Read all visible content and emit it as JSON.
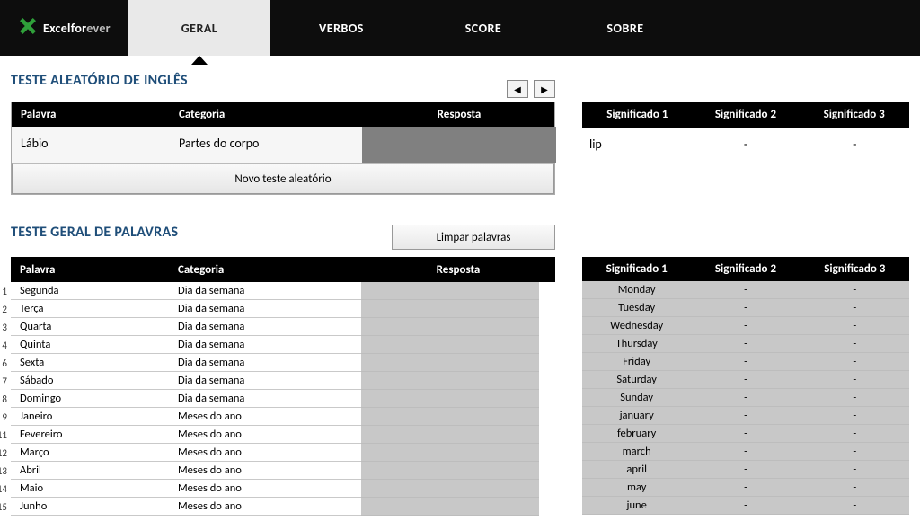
{
  "brand": {
    "name1": "Excel",
    "name2": "for",
    "name3": "ever"
  },
  "tabs": [
    {
      "label": "GERAL",
      "active": true
    },
    {
      "label": "VERBOS",
      "active": false
    },
    {
      "label": "SCORE",
      "active": false
    },
    {
      "label": "SOBRE",
      "active": false
    }
  ],
  "random_test": {
    "title": "TESTE ALEATÓRIO DE INGLÊS",
    "headers": {
      "word": "Palavra",
      "category": "Categoria",
      "answer": "Resposta"
    },
    "row": {
      "word": "Lábio",
      "category": "Partes do corpo",
      "answer": ""
    },
    "button": "Novo teste aleatório",
    "meaning_headers": {
      "m1": "Significado 1",
      "m2": "Significado 2",
      "m3": "Significado 3"
    },
    "meanings": {
      "m1": "lip",
      "m2": "-",
      "m3": "-"
    }
  },
  "word_test": {
    "title": "TESTE GERAL DE PALAVRAS",
    "clear_button": "Limpar palavras",
    "headers": {
      "word": "Palavra",
      "category": "Categoria",
      "answer": "Resposta"
    },
    "meaning_headers": {
      "m1": "Significado 1",
      "m2": "Significado 2",
      "m3": "Significado 3"
    },
    "rows": [
      {
        "n": "1",
        "word": "Segunda",
        "category": "Dia da semana",
        "m1": "Monday",
        "m2": "-",
        "m3": "-"
      },
      {
        "n": "2",
        "word": "Terça",
        "category": "Dia da semana",
        "m1": "Tuesday",
        "m2": "-",
        "m3": "-"
      },
      {
        "n": "3",
        "word": "Quarta",
        "category": "Dia da semana",
        "m1": "Wednesday",
        "m2": "-",
        "m3": "-"
      },
      {
        "n": "4",
        "word": "Quinta",
        "category": "Dia da semana",
        "m1": "Thursday",
        "m2": "-",
        "m3": "-"
      },
      {
        "n": "6",
        "word": "Sexta",
        "category": "Dia da semana",
        "m1": "Friday",
        "m2": "-",
        "m3": "-"
      },
      {
        "n": "7",
        "word": "Sábado",
        "category": "Dia da semana",
        "m1": "Saturday",
        "m2": "-",
        "m3": "-"
      },
      {
        "n": "8",
        "word": "Domingo",
        "category": "Dia da semana",
        "m1": "Sunday",
        "m2": "-",
        "m3": "-"
      },
      {
        "n": "9",
        "word": "Janeiro",
        "category": "Meses do ano",
        "m1": "january",
        "m2": "-",
        "m3": "-"
      },
      {
        "n": "11",
        "word": "Fevereiro",
        "category": "Meses do ano",
        "m1": "february",
        "m2": "-",
        "m3": "-"
      },
      {
        "n": "12",
        "word": "Março",
        "category": "Meses do ano",
        "m1": "march",
        "m2": "-",
        "m3": "-"
      },
      {
        "n": "13",
        "word": "Abril",
        "category": "Meses do ano",
        "m1": "april",
        "m2": "-",
        "m3": "-"
      },
      {
        "n": "14",
        "word": "Maio",
        "category": "Meses do ano",
        "m1": "may",
        "m2": "-",
        "m3": "-"
      },
      {
        "n": "15",
        "word": "Junho",
        "category": "Meses do ano",
        "m1": "june",
        "m2": "-",
        "m3": "-"
      }
    ]
  }
}
